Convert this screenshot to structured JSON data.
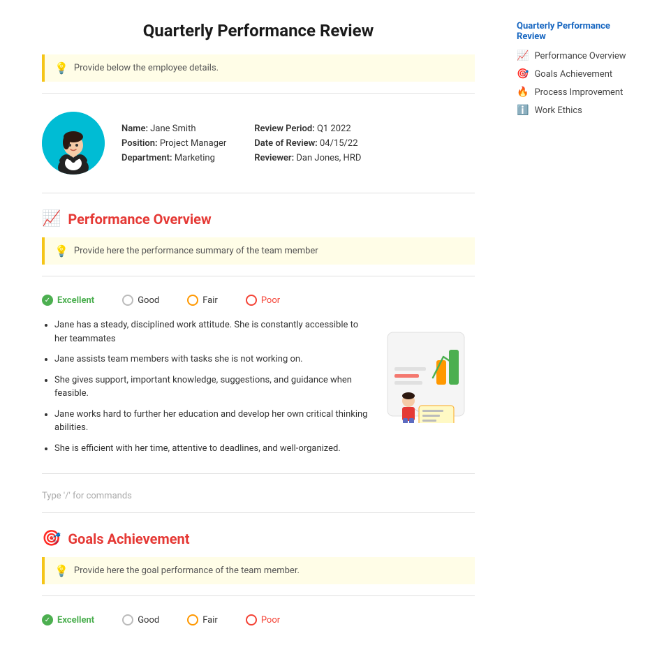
{
  "page": {
    "title": "Quarterly Performance Review"
  },
  "hint": {
    "employee_details": "Provide below the employee details.",
    "performance_summary": "Provide here the performance summary of the team member",
    "goals_hint": "Provide here the goal performance of the team member."
  },
  "employee": {
    "name_label": "Name:",
    "name_value": "Jane Smith",
    "position_label": "Position:",
    "position_value": "Project Manager",
    "department_label": "Department:",
    "department_value": "Marketing",
    "review_period_label": "Review Period:",
    "review_period_value": "Q1 2022",
    "date_label": "Date of Review:",
    "date_value": "04/15/22",
    "reviewer_label": "Reviewer:",
    "reviewer_value": "Dan Jones, HRD"
  },
  "performance": {
    "section_title": "Performance Overview",
    "ratings": [
      {
        "label": "Excellent",
        "selected": true,
        "style": "excellent"
      },
      {
        "label": "Good",
        "selected": false,
        "style": "good"
      },
      {
        "label": "Fair",
        "selected": false,
        "style": "fair"
      },
      {
        "label": "Poor",
        "selected": false,
        "style": "poor"
      }
    ],
    "bullets": [
      "Jane has a steady, disciplined work attitude. She is constantly accessible to her teammates",
      "Jane assists team members with tasks she is not working on.",
      "She gives support, important knowledge, suggestions, and guidance when feasible.",
      "Jane works hard to further her education and develop her own critical thinking abilities.",
      "She is efficient with her time, attentive to deadlines, and well-organized."
    ],
    "type_hint": "Type '/' for commands"
  },
  "goals": {
    "section_title": "Goals Achievement"
  },
  "sidebar": {
    "title": "Quarterly Performance Review",
    "nav_items": [
      {
        "label": "Performance Overview",
        "icon": "📈",
        "color": "nav-performance"
      },
      {
        "label": "Goals Achievement",
        "icon": "🎯",
        "color": "nav-goals"
      },
      {
        "label": "Process Improvement",
        "icon": "🔥",
        "color": "nav-process"
      },
      {
        "label": "Work Ethics",
        "icon": "ℹ️",
        "color": "nav-ethics"
      }
    ]
  }
}
